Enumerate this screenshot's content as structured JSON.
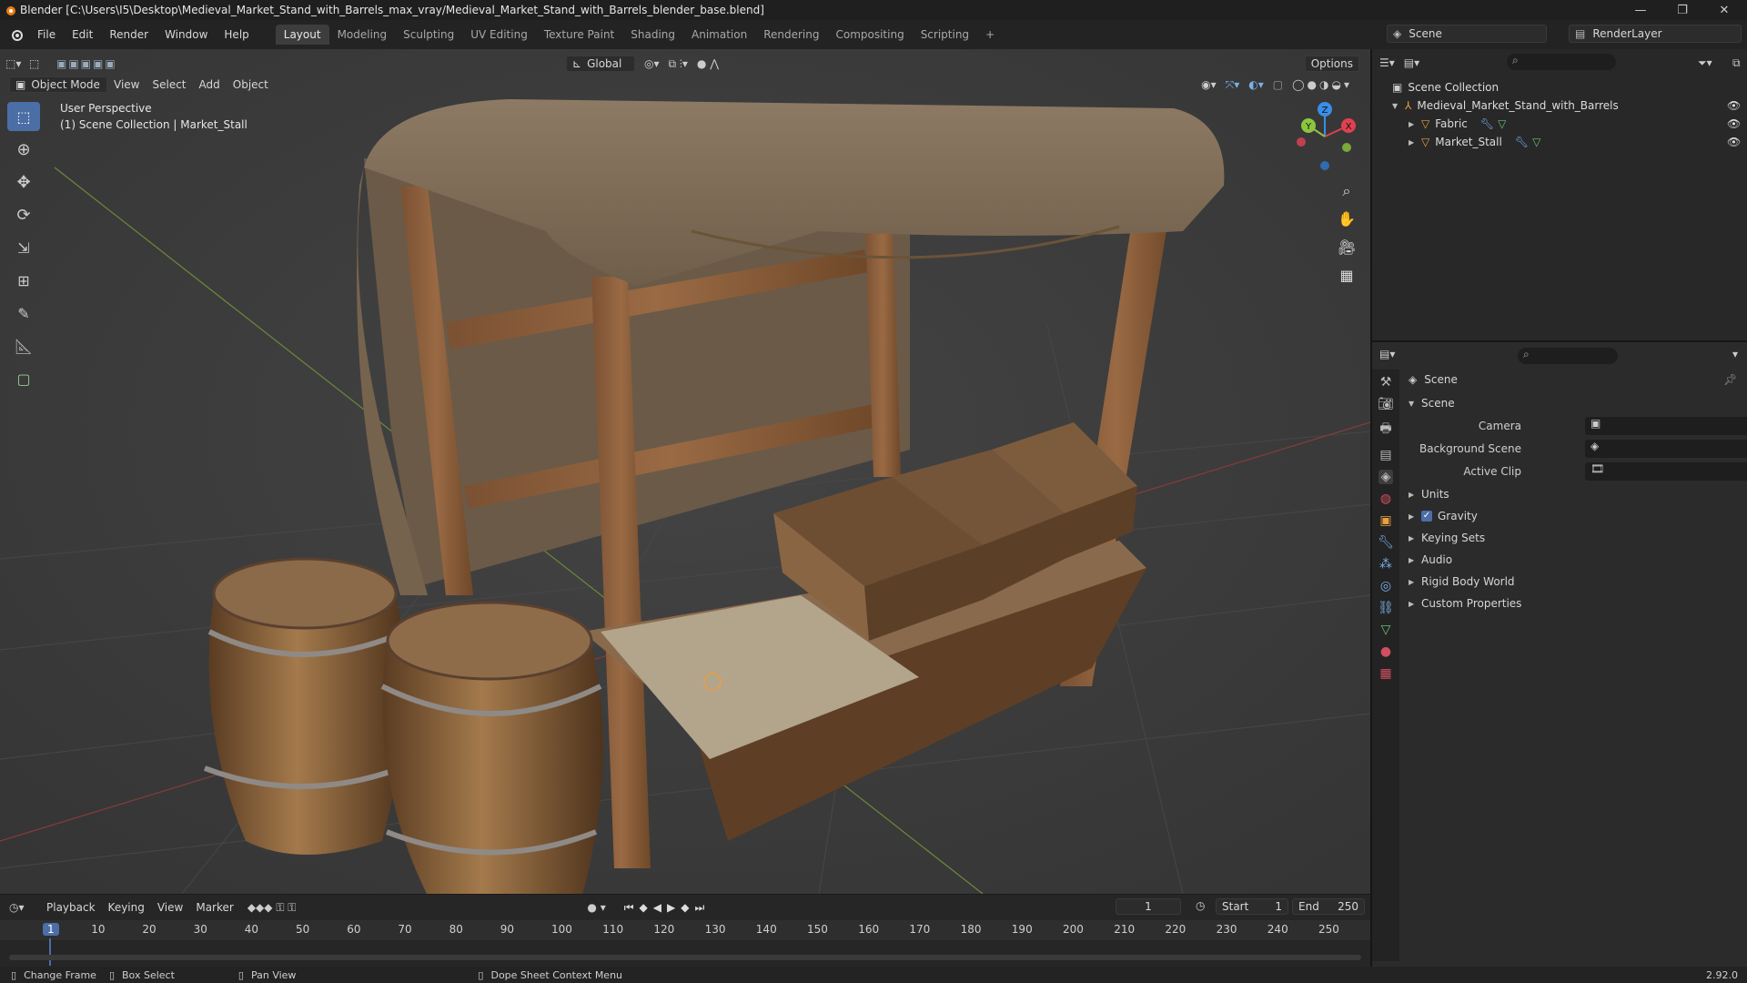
{
  "window": {
    "title": "Blender [C:\\Users\\I5\\Desktop\\Medieval_Market_Stand_with_Barrels_max_vray/Medieval_Market_Stand_with_Barrels_blender_base.blend]"
  },
  "menus": [
    "File",
    "Edit",
    "Render",
    "Window",
    "Help"
  ],
  "workspaces": [
    "Layout",
    "Modeling",
    "Sculpting",
    "UV Editing",
    "Texture Paint",
    "Shading",
    "Animation",
    "Rendering",
    "Compositing",
    "Scripting"
  ],
  "active_workspace": "Layout",
  "scene_field": "Scene",
  "view_layer_field": "RenderLayer",
  "transform": {
    "orientation": "Global",
    "options": "Options"
  },
  "viewport": {
    "mode": "Object Mode",
    "menus": [
      "View",
      "Select",
      "Add",
      "Object"
    ],
    "overlay_line1": "User Perspective",
    "overlay_line2": "(1) Scene Collection | Market_Stall",
    "gizmo": {
      "x": "X",
      "y": "Y",
      "z": "Z"
    }
  },
  "outliner": {
    "root": "Scene Collection",
    "items": [
      {
        "name": "Medieval_Market_Stand_with_Barrels"
      },
      {
        "name": "Fabric"
      },
      {
        "name": "Market_Stall"
      }
    ]
  },
  "properties": {
    "header": "Scene",
    "panel": "Scene",
    "fields": [
      {
        "label": "Camera"
      },
      {
        "label": "Background Scene"
      },
      {
        "label": "Active Clip"
      }
    ],
    "sections": [
      "Units",
      "Gravity",
      "Keying Sets",
      "Audio",
      "Rigid Body World",
      "Custom Properties"
    ],
    "gravity_checked": true
  },
  "timeline": {
    "menus": [
      "Playback",
      "Keying",
      "View",
      "Marker"
    ],
    "current_frame": "1",
    "start_label": "Start",
    "start": "1",
    "end_label": "End",
    "end": "250",
    "ruler": [
      "1",
      "10",
      "20",
      "30",
      "40",
      "50",
      "60",
      "70",
      "80",
      "90",
      "100",
      "110",
      "120",
      "130",
      "140",
      "150",
      "160",
      "170",
      "180",
      "190",
      "200",
      "210",
      "220",
      "230",
      "240",
      "250"
    ]
  },
  "status": {
    "items": [
      "Change Frame",
      "Box Select",
      "Pan View",
      "Dope Sheet Context Menu"
    ],
    "version": "2.92.0"
  },
  "colors": {
    "accent": "#4b6ea6",
    "x_axis": "#e04050",
    "y_axis": "#8cc63f",
    "z_axis": "#3a8ee6"
  }
}
